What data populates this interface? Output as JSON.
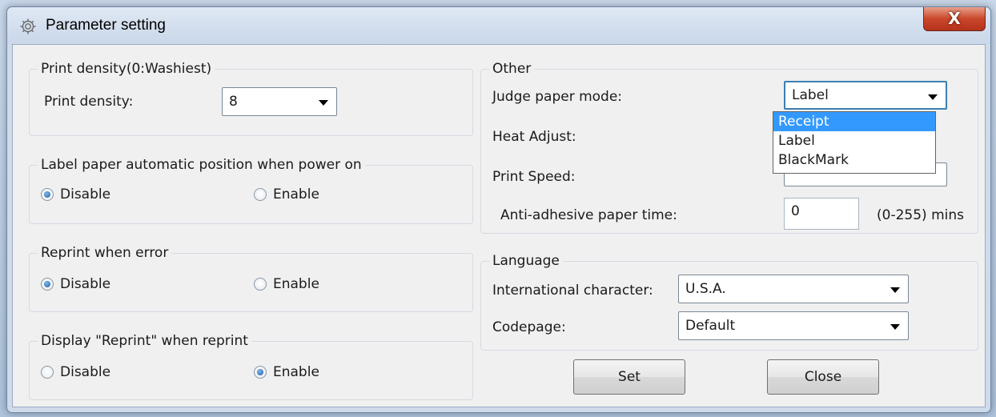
{
  "window": {
    "title": "Parameter setting",
    "close_glyph": "X"
  },
  "print_density": {
    "legend": "Print density(0:Washiest)",
    "label": "Print density:",
    "value": "8"
  },
  "label_auto_position": {
    "legend": "Label paper automatic position when power on",
    "options": [
      "Disable",
      "Enable"
    ],
    "selected": "Disable"
  },
  "reprint_error": {
    "legend": "Reprint when error",
    "options": [
      "Disable",
      "Enable"
    ],
    "selected": "Disable"
  },
  "display_reprint": {
    "legend": "Display \"Reprint\" when reprint",
    "options": [
      "Disable",
      "Enable"
    ],
    "selected": "Enable"
  },
  "other": {
    "legend": "Other",
    "judge_label": "Judge paper mode:",
    "judge_value": "Label",
    "judge_options": [
      "Receipt",
      "Label",
      "BlackMark"
    ],
    "judge_highlighted": "Receipt",
    "heat_label": "Heat Adjust:",
    "speed_label": "Print Speed:",
    "anti_label": "Anti-adhesive paper time:",
    "anti_value": "0",
    "anti_range": "(0-255) mins"
  },
  "language": {
    "legend": "Language",
    "intl_label": "International character:",
    "intl_value": "U.S.A.",
    "codepage_label": "Codepage:",
    "codepage_value": "Default"
  },
  "buttons": {
    "set": "Set",
    "close": "Close"
  },
  "colors": {
    "selection": "#3399ff",
    "close_button": "#c9472a",
    "focus_border": "#3c7fb1"
  }
}
